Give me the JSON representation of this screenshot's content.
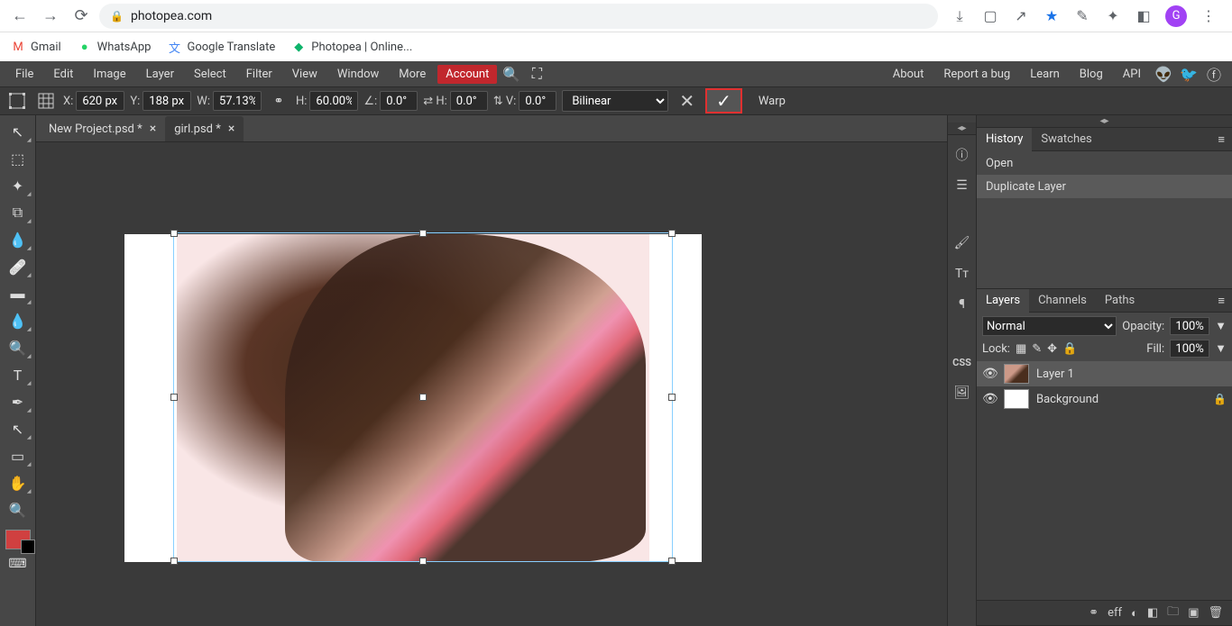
{
  "browser": {
    "url": "photopea.com",
    "profile_initial": "G",
    "bookmarks": [
      {
        "label": "Gmail",
        "icon": "gmail"
      },
      {
        "label": "WhatsApp",
        "icon": "whatsapp"
      },
      {
        "label": "Google Translate",
        "icon": "gt"
      },
      {
        "label": "Photopea | Online...",
        "icon": "pp"
      }
    ]
  },
  "menu": {
    "left": [
      "File",
      "Edit",
      "Image",
      "Layer",
      "Select",
      "Filter",
      "View",
      "Window",
      "More"
    ],
    "account": "Account",
    "right": [
      "About",
      "Report a bug",
      "Learn",
      "Blog",
      "API"
    ]
  },
  "options": {
    "x_label": "X:",
    "x_value": "620 px",
    "y_label": "Y:",
    "y_value": "188 px",
    "w_label": "W:",
    "w_value": "57.13%",
    "h_label": "H:",
    "h_value": "60.00%",
    "angle_label": "∠:",
    "angle_value": "0.0°",
    "skew_h_label": "⇄ H:",
    "skew_h_value": "0.0°",
    "skew_v_label": "⇅ V:",
    "skew_v_value": "0.0°",
    "interpolation": "Bilinear",
    "warp_label": "Warp"
  },
  "tabs": [
    {
      "label": "New Project.psd *",
      "active": false
    },
    {
      "label": "girl.psd *",
      "active": true
    }
  ],
  "panels": {
    "history_tabs": [
      "History",
      "Swatches"
    ],
    "history_items": [
      "Open",
      "Duplicate Layer"
    ],
    "layers_tabs": [
      "Layers",
      "Channels",
      "Paths"
    ],
    "blend_mode": "Normal",
    "opacity_label": "Opacity:",
    "opacity_value": "100%",
    "lock_label": "Lock:",
    "fill_label": "Fill:",
    "fill_value": "100%",
    "layers": [
      {
        "name": "Layer 1",
        "selected": true,
        "locked": false,
        "thumb": "img"
      },
      {
        "name": "Background",
        "selected": false,
        "locked": true,
        "thumb": "plain"
      }
    ]
  }
}
